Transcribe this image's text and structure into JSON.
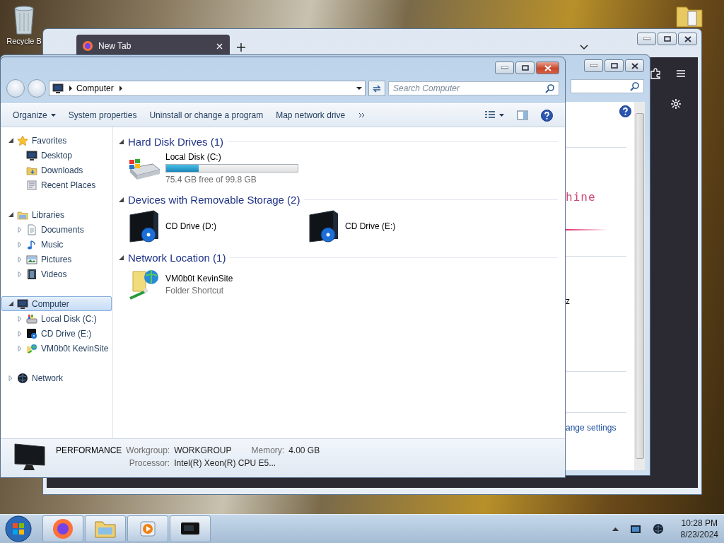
{
  "desktop": {
    "icons": [
      {
        "label": "Recycle B"
      }
    ]
  },
  "browser": {
    "tabs": [
      {
        "label": "New Tab",
        "selected": true
      }
    ]
  },
  "control_panel": {
    "texts": [
      {
        "kind": "heading",
        "text": "hine"
      },
      {
        "kind": "value",
        "text": "z"
      },
      {
        "kind": "link",
        "text": "ange settings"
      }
    ]
  },
  "explorer": {
    "address": [
      "Computer"
    ],
    "search": {
      "placeholder": "Search Computer"
    },
    "commands": [
      {
        "label": "Organize",
        "menu": true
      },
      {
        "label": "System properties",
        "menu": false
      },
      {
        "label": "Uninstall or change a program",
        "menu": false
      },
      {
        "label": "Map network drive",
        "menu": false
      }
    ],
    "nav": [
      {
        "label": "Favorites",
        "expanded": true,
        "selected": false,
        "children": [
          {
            "label": "Desktop",
            "selected": false
          },
          {
            "label": "Downloads",
            "selected": false
          },
          {
            "label": "Recent Places",
            "selected": false
          }
        ]
      },
      {
        "label": "Libraries",
        "expanded": true,
        "selected": false,
        "children": [
          {
            "label": "Documents",
            "expanded": false,
            "selected": false
          },
          {
            "label": "Music",
            "expanded": false,
            "selected": false
          },
          {
            "label": "Pictures",
            "expanded": false,
            "selected": false
          },
          {
            "label": "Videos",
            "expanded": false,
            "selected": false
          }
        ]
      },
      {
        "label": "Computer",
        "expanded": true,
        "selected": true,
        "children": [
          {
            "label": "Local Disk (C:)",
            "expanded": false,
            "selected": false
          },
          {
            "label": "CD Drive (E:)",
            "expanded": false,
            "selected": false
          },
          {
            "label": "VM0b0t KevinSite",
            "expanded": false,
            "selected": false
          }
        ]
      },
      {
        "label": "Network",
        "expanded": false,
        "selected": false
      }
    ],
    "groups": [
      {
        "title": "Hard Disk Drives (1)",
        "expanded": true,
        "items": [
          {
            "kind": "drive",
            "name": "Local Disk (C:)",
            "level": 0.245,
            "detail": "75.4 GB free of 99.8 GB"
          }
        ]
      },
      {
        "title": "Devices with Removable Storage (2)",
        "expanded": true,
        "items": [
          {
            "kind": "device",
            "name": "CD Drive (D:)"
          },
          {
            "kind": "device",
            "name": "CD Drive (E:)"
          }
        ]
      },
      {
        "title": "Network Location (1)",
        "expanded": true,
        "items": [
          {
            "kind": "shortcut",
            "name": "VM0b0t KevinSite",
            "detail": "Folder Shortcut"
          }
        ]
      }
    ],
    "details": {
      "name": "PERFORMANCE",
      "fields": [
        {
          "label": "Workgroup:",
          "value": "WORKGROUP"
        },
        {
          "label": "Memory:",
          "value": "4.00 GB"
        },
        {
          "label": "Processor:",
          "value": "Intel(R) Xeon(R) CPU E5..."
        }
      ]
    }
  },
  "taskbar": {
    "clock": {
      "time": "10:28 PM",
      "date": "8/23/2024"
    }
  }
}
